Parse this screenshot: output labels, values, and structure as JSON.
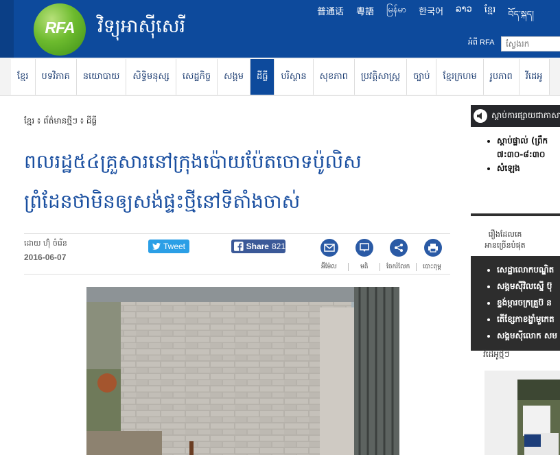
{
  "header": {
    "site_name": "វិទ្យុអាស៊ីសេរី",
    "logo_text": "RFA",
    "languages": [
      "普通话",
      "粵語",
      "မြန်မာ",
      "한국어",
      "ລາວ",
      "ខ្មែរ",
      "བོད་སྐད།"
    ],
    "about_link": "អំពី RFA",
    "search_placeholder": "ស្វែងរក"
  },
  "nav": {
    "items": [
      "ខ្មែរ",
      "បទវិភាគ",
      "នយោបាយ",
      "សិទ្ធិមនុស្ស",
      "សេដ្ឋកិច្ច",
      "សង្គម",
      "ដីធ្លី",
      "បរិស្ថាន",
      "សុខភាព",
      "ប្រវត្តិសាស្ត្រ",
      "ច្បាប់",
      "ខ្មែរក្រហម",
      "រូបភាព",
      "វីដេអូ"
    ],
    "active_index": 6
  },
  "article": {
    "breadcrumb": "ខ្មែរ ៖ ព័ត៌មានថ្មីៗ ៖ ដីធ្លី",
    "headline_line1": "ពលរដ្ឋ៥៤គ្រួសារនៅក្រុងប៉ោយប៉ែតចោទប៉ូលិស",
    "headline_line2": "ព្រំដែនថាមិនឲ្យសង់ផ្ទះថ្មីនៅទីតាំងចាស់",
    "byline": "ដោយ ហ៊ុំ ចំរើន",
    "date": "2016-06-07",
    "tweet_label": "Tweet",
    "share_label": "Share",
    "share_count": "821",
    "tools": [
      {
        "icon": "email-icon",
        "label": "អ៊ីម៉ែល"
      },
      {
        "icon": "comment-icon",
        "label": "មតិ"
      },
      {
        "icon": "share-icon",
        "label": "ចែករំលែក"
      },
      {
        "icon": "print-icon",
        "label": "បោះពុម្ព"
      }
    ]
  },
  "sidebar": {
    "listen_title": "ស្តាប់ការផ្សាយជាភាសា",
    "listen_items": [
      "ស្តាប់ផ្ទាល់ (ព្រឹក",
      "៧:៣០-៨:៣០",
      "សំឡេង"
    ],
    "popular_title_line1": "រឿងដែលគេ",
    "popular_title_line2": "អានច្រើនបំផុត",
    "popular_items": [
      "សេដ្ឋាលោកបណ្ឌិត ",
      "សង្គមស៊ីវិលស្នើ ប៊ុ",
      "ខ្ទង់ម្ការចក្រគ្រួប៊ ន",
      "តើខ្សែកាខង្ខាំមួកេត",
      "សង្គមស៊ីលោក សម រ"
    ],
    "video_label": "វីដេអូថ្មីៗ"
  }
}
